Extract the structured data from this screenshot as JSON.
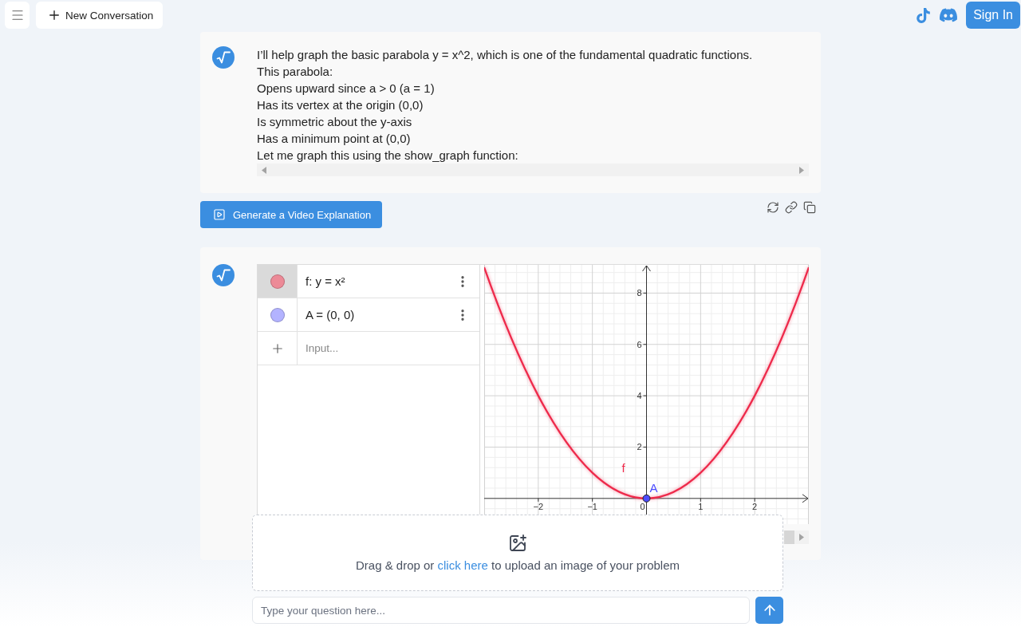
{
  "header": {
    "new_conversation": "New Conversation",
    "sign_in": "Sign In"
  },
  "messages": [
    {
      "kind": "text",
      "lines": [
        "I’ll help graph the basic parabola y = x^2, which is one of the fundamental quadratic functions.",
        "This parabola:",
        "Opens upward since a > 0 (a = 1)",
        "Has its vertex at the origin (0,0)",
        "Is symmetric about the y-axis",
        "Has a minimum point at (0,0)",
        "Let me graph this using the show_graph function:"
      ],
      "video_button": "Generate a Video Explanation"
    },
    {
      "kind": "graph",
      "algebra": {
        "items": [
          {
            "text": "f: y = x²",
            "color": "#ec8a97",
            "selected": true
          },
          {
            "text": "A = (0, 0)",
            "color": "#b3b3ff",
            "selected": false
          }
        ],
        "input": {
          "placeholder": "Input..."
        }
      },
      "chart_data": {
        "type": "line",
        "grid": true,
        "x": [
          -3,
          -2,
          -1,
          0,
          1,
          2,
          3
        ],
        "series": [
          {
            "name": "f",
            "color": "#ee2a4b",
            "values": [
              9,
              4,
              1,
              0,
              1,
              4,
              9
            ]
          },
          {
            "name": "A",
            "color": "#4d4dff",
            "marker": true,
            "values": [
              null,
              null,
              null,
              0,
              null,
              null,
              null
            ]
          }
        ],
        "xlim": [
          -3,
          3
        ],
        "ylim": [
          -1,
          9.1
        ],
        "xticks": [
          {
            "value": -2,
            "label": "−2"
          },
          {
            "value": -1,
            "label": "−1"
          },
          {
            "value": 0,
            "label": "0"
          },
          {
            "value": 1,
            "label": "1"
          },
          {
            "value": 2,
            "label": "2"
          }
        ],
        "yticks": [
          2,
          4,
          6,
          8
        ]
      }
    }
  ],
  "composer": {
    "upload_hint": {
      "before": "Drag & drop or ",
      "link": "click here",
      "after": " to upload an image of your problem"
    },
    "question": {
      "placeholder": "Type your question here..."
    }
  }
}
